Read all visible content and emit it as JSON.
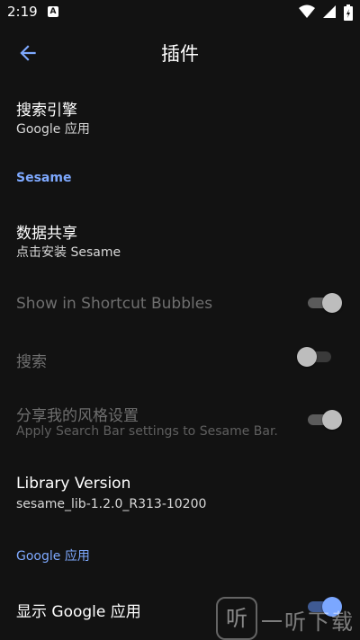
{
  "status_bar": {
    "time": "2:19",
    "notification_badge": "A",
    "icons": [
      "wifi-icon",
      "signal-icon",
      "battery-icon"
    ]
  },
  "app_bar": {
    "title": "插件",
    "back_icon": "arrow-back-icon"
  },
  "items": {
    "search_engine": {
      "title": "搜索引擎",
      "summary": "Google 应用"
    },
    "sesame_header": "Sesame",
    "data_sharing": {
      "title": "数据共享",
      "summary": "点击安装 Sesame"
    },
    "shortcut_bubbles": {
      "title": "Show in Shortcut Bubbles",
      "enabled": false,
      "checked": true
    },
    "search": {
      "title": "搜索",
      "enabled": false,
      "checked": false
    },
    "share_style": {
      "title": "分享我的风格设置",
      "summary": "Apply Search Bar settings to Sesame Bar.",
      "enabled": false,
      "checked": true
    },
    "library_version": {
      "title": "Library Version",
      "summary": "sesame_lib-1.2.0_R313-10200"
    },
    "google_header": "Google 应用",
    "show_google": {
      "title": "显示 Google 应用",
      "enabled": true,
      "checked": true
    }
  },
  "watermark": {
    "logo_glyph": "听",
    "text": "一听下载"
  },
  "colors": {
    "background": "#121212",
    "accent": "#7ea9ff",
    "switch_active": "#7ba7ff"
  }
}
